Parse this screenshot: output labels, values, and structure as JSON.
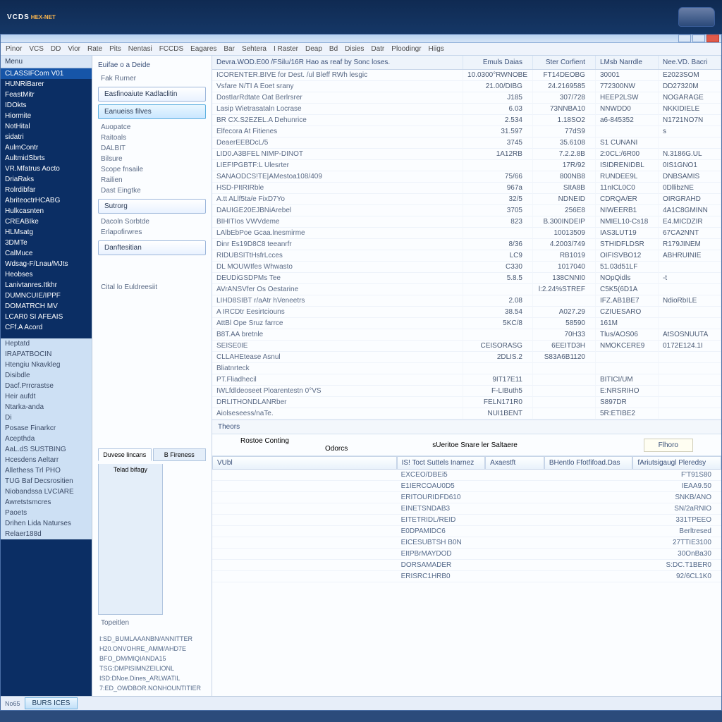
{
  "brand": {
    "name": "VCDS",
    "sub": "HEX-NET"
  },
  "menu": [
    "Pinor",
    "VCS",
    "DD",
    "Vior",
    "Rate",
    "Pits",
    "Nentasi",
    "FCCDS",
    "Eagares",
    "Bar",
    "Sehtera",
    "I Raster",
    "Deap",
    "Bd",
    "Disies",
    "Datr",
    "Ploodingr",
    "Hiigs"
  ],
  "leftnav": {
    "header": "Menu",
    "groupA": [
      "CLASSIFCom V01",
      "HUNRiBarer",
      "FeastMitr",
      "IDOkts",
      "Hiormite",
      "NotHital",
      "sidatri",
      "AulmContr",
      "AultmidSbrts",
      "VR.Mfatrus Aocto",
      "DriaRaks",
      "Rolrdibfar",
      "AbriteoctrHCABG",
      "Hulkcasnten",
      "CREABIke",
      "HLMsatg",
      "3DMTe",
      "CalMuce",
      "Wdsag-F/Lnau/MJts",
      "Heobses",
      "Lanivtanres.Itkhr",
      "DUMNCUIE/IPPF",
      "DOMATRCH MV",
      "LCAR0 SI AFEAIS",
      "CFf.A Acord"
    ],
    "groupB": [
      "Heptatd",
      "IRAPATBOCIN",
      "Htengiu Nkavkleg",
      "Disibdle",
      "Dacf.Prrcrastse",
      "Heir aufdt",
      "Ntarka-anda",
      "Di",
      "Posase Finarkcr",
      "Acepthda",
      "AaL.dS SUSTBING",
      "Hcesdens Aeltarr",
      "Allethess Trl PHO",
      "TUG Baf Decsrositien",
      "Niobandssa LVCIARE",
      "Awretstsmcres",
      "Paoets",
      "Drihen Lida Naturses",
      "Relaer188d"
    ]
  },
  "mid": {
    "header": "Euifae o a Deide",
    "sub": "Fak Rurner",
    "btn1": "Easfinoaiute Kadlaclitin",
    "btn2": "Eanueiss filves",
    "items1": [
      "Auopatce",
      "Raitoals",
      "DALBIT",
      "Bilsure",
      "Scope fnsaile",
      "Railien",
      "Dast Eingtke"
    ],
    "btn3": "Sutrorg",
    "items2": [
      "Dacoln Sorbtde",
      "Erlapofirwres"
    ],
    "btn4": "Danftesitian",
    "footer": "Cital lo Euldreesiit",
    "tabs": [
      "Duvese lincans",
      "B Fireness",
      "Telad bifagy"
    ],
    "loghdr": "Topeitlen",
    "logs": [
      "I:SD_BUMLAAANBN/ANNITTER",
      "H20.ONVOHRE_AMM/AHD7E",
      "BFO_DM/MIQIANDA15",
      "TSG:DMPISIMNZEILIONL",
      "ISD:DNoe.Dines_ARLWATIL",
      "7:ED_OWDBOR.NONHOUNTITIER"
    ]
  },
  "main": {
    "title": "Devra.WOD.E00 /FSilu/16R Hao as reaf by Sonc loses.",
    "cols": [
      "",
      "Emuls Daias",
      "Ster Corfient",
      "LMsb Narrdle",
      "Nee.VD. Bacri"
    ],
    "rows": [
      [
        "ICORENTER.BIVE for Dest. /ul Bleff RWh lesgic",
        "10.0300°RWNOBE",
        "FT14DEOBG",
        "30001",
        "E2023SOM"
      ],
      [
        "Vsfare N/TI A Eoet srany",
        "21.00/DIBG",
        "24.2169585",
        "772300NW",
        "DD27320M"
      ],
      [
        "DostIarRdtate Oat Berlrsrer",
        "J185",
        "307/728",
        "HEEP2LSW",
        "NOGARAGE"
      ],
      [
        "Lasip Wietrasataln Locrase",
        "6.03",
        "73NNBA10",
        "NNWDD0",
        "NKKIDIELE"
      ],
      [
        "BR CX.S2EZEL.A Dehunrice",
        "2.534",
        "1.18SO2",
        "a6-845352",
        "N1721NO7N"
      ],
      [
        "Elfecora At Fitienes",
        "31.597",
        "77dS9",
        "",
        "s"
      ],
      [
        "DeaerEEBDcL/5",
        "3745",
        "35.6108",
        "S1 CUNANI",
        ""
      ],
      [
        "LID0.A3BFEL NIMP-DINOT",
        "1A12RB",
        "7.2.2.8B",
        "2:0CL:/6R00",
        "N.3186G.UL"
      ],
      [
        "LIEF!PGBTF:L Ulesrter",
        "",
        "17R/92",
        "ISIDRENIDBL",
        "0IS1GNO1"
      ],
      [
        "SANAODCS!TE|AMestoa108/409",
        "75/66",
        "800NB8",
        "RUNDEE9L",
        "DNBSAMIS"
      ],
      [
        "HSD-PItRIRble",
        "967a",
        "SItA8B",
        "11nICL0C0",
        "0DllibzNE"
      ],
      [
        "A.tt ALlf5ta/e FixD7Yo",
        "32/5",
        "NDNEID",
        "CDRQA/ER",
        "OIRGRAHD"
      ],
      [
        "DAUIGE20EJBNiArebel",
        "3705",
        "256E8",
        "NIWEERB1",
        "4A1C8GMINN"
      ],
      [
        "BIHITIos VWVdeme",
        "823",
        "B.300INDEIP",
        "NMIEL10-Cs18",
        "E4.MICDZIR"
      ],
      [
        "LAlbEbPoe Gcaa.lnesmirme",
        "",
        "10013509",
        "IAS3LUT19",
        "67CA2NNT"
      ],
      [
        "Dinr Es19D8C8 teeanrfr",
        "8/36",
        "4.2003/749",
        "STHIDFLDSR",
        "R179JINEM"
      ],
      [
        "RIDUBSITtHsfrLcces",
        "LC9",
        "RB1019",
        "OIFISVBO12",
        "ABHRUINIE"
      ],
      [
        "DL MOUWIfes Whwasto",
        "C330",
        "1017040",
        "51.03d51LF",
        ""
      ],
      [
        "DEUDiGSDPMs Tee",
        "5.8.5",
        "138CNNI0",
        "NOpQidls",
        "-t"
      ],
      [
        "AVrANSVfer Os Oestarine",
        "",
        "l:2.24%STREF",
        "C5K5(6D1A",
        ""
      ],
      [
        "LIHD8SIBT r/aAtr hVeneetrs",
        "2.08",
        "",
        "IFZ.AB1BE7",
        "NdioRbILE"
      ],
      [
        "A IRCDtr Eesirtciouns",
        "38.54",
        "A027.29",
        "CZIUESARO",
        ""
      ],
      [
        "AttBl Ope Sruz farrce",
        "5KC/8",
        "58590",
        "161M",
        ""
      ],
      [
        "B8T.AA bretnle",
        "",
        "70H33",
        "Tlus/AOS06",
        "AtSOSNUUTA"
      ],
      [
        "SEISE0IE",
        "CEISORASG",
        "6EEITD3H",
        "NMOKCERE9",
        "0172E124.1I"
      ],
      [
        "CLLAHEtease Asnul",
        "2DLIS.2",
        "S83A6B1120",
        "",
        ""
      ],
      [
        "  Bliatnrteck",
        "",
        "",
        "",
        ""
      ],
      [
        "PT.Fliadhecil",
        "9IT17E11",
        "",
        "BITICI/UM",
        ""
      ],
      [
        "IWLfdldeoseet Ploarentestn     0°VS",
        "F-LIButh5",
        "",
        "E:NRSRIHO",
        ""
      ],
      [
        "DRLITHONDLANRber",
        "FELN171R0",
        "",
        "S897DR",
        ""
      ],
      [
        "Aiolseseess/naTe.",
        "NUI1BENT",
        "",
        "5R:ETIBE2",
        ""
      ]
    ],
    "section2": "Theors",
    "tab_a": "Rostoe Conting",
    "tab_b": "sUeritoe Snare ler Saltaere",
    "tab_sub": "Odorcs",
    "tab_right": "Flhoro",
    "btm_cols": [
      "VUbl",
      "IS! Toct Suttels Inarnez",
      "Axaestft",
      "BHentlo Ffotfifoad.Das",
      "fAriutsigaugl Pleredsy"
    ],
    "btm_rows": [
      [
        "",
        "EXCEO/DBEi5",
        "",
        "",
        "F'T91S80"
      ],
      [
        "",
        "E1IERCOAU0D5",
        "",
        "",
        "IEAA9.50"
      ],
      [
        "",
        "ERITOURIDFD610",
        "",
        "",
        "SNKB/ANO"
      ],
      [
        "",
        "EINETSNDAB3",
        "",
        "",
        "SN/2aRNIO"
      ],
      [
        "",
        "EITETRIDL/REID",
        "",
        "",
        "331TPEEO"
      ],
      [
        "",
        "E0DPAMIDC6",
        "",
        "",
        "Berltresed"
      ],
      [
        "",
        "EICESUBTSH B0N",
        "",
        "",
        "27TTIE3100"
      ],
      [
        "",
        "EItPBrMAYDOD",
        "",
        "",
        "30OnBa30"
      ],
      [
        "",
        "DORSAMADER",
        "",
        "",
        "S:DC.T1BER0"
      ],
      [
        "",
        "ERISRC1HRB0",
        "",
        "",
        "92/6CL1K0"
      ]
    ]
  },
  "status": {
    "txt": "No65",
    "btn": "BURS ICES"
  }
}
